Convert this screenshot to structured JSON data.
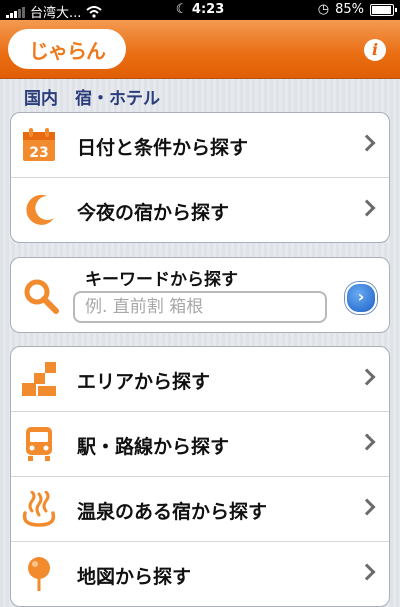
{
  "status_bar": {
    "carrier": "台湾大...",
    "time": "4:23",
    "battery": "85%"
  },
  "header": {
    "logo_text": "じゃらん",
    "info_icon": "i"
  },
  "breadcrumb": "国内　宿・ホテル",
  "menu_group_1": [
    {
      "label": "日付と条件から探す",
      "icon": "calendar-icon",
      "calendar_day": "23"
    },
    {
      "label": "今夜の宿から探す",
      "icon": "moon-icon"
    }
  ],
  "keyword_search": {
    "title": "キーワードから探す",
    "placeholder": "例. 直前割 箱根",
    "value": ""
  },
  "menu_group_2": [
    {
      "label": "エリアから探す",
      "icon": "area-blocks-icon"
    },
    {
      "label": "駅・路線から探す",
      "icon": "train-icon"
    },
    {
      "label": "温泉のある宿から探す",
      "icon": "hot-spring-icon"
    },
    {
      "label": "地図から探す",
      "icon": "map-pin-icon"
    }
  ],
  "colors": {
    "brand_orange": "#ea6d12",
    "breadcrumb": "#2b3d7a",
    "go_button": "#1b62c8"
  }
}
